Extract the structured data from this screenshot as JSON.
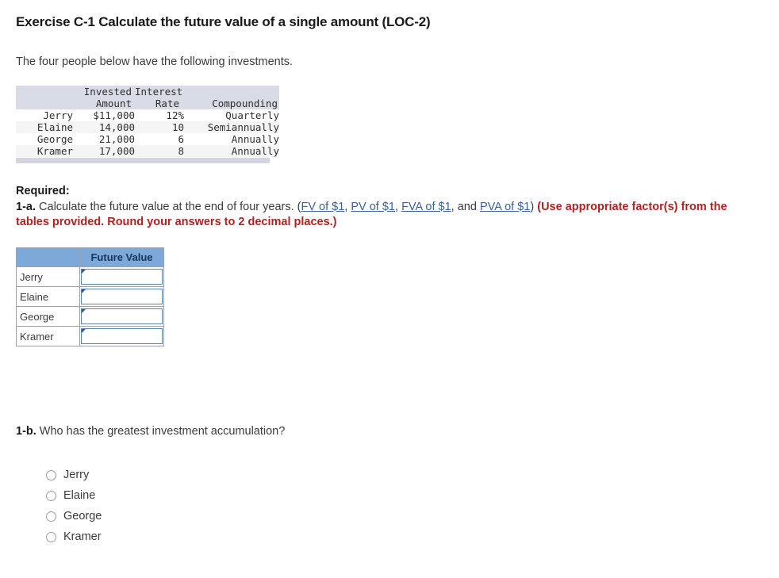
{
  "title": "Exercise C-1 Calculate the future value of a single amount (LOC-2)",
  "intro": "The four people below have the following investments.",
  "data_table": {
    "headers": {
      "name": "",
      "invested_amount_line1": "Invested",
      "invested_amount_line2": "Amount",
      "interest_rate_line1": "Interest",
      "interest_rate_line2": "Rate",
      "compounding": "Compounding"
    },
    "rows": [
      {
        "name": "Jerry",
        "amount": "$11,000",
        "rate": "12%",
        "compounding": "Quarterly"
      },
      {
        "name": "Elaine",
        "amount": "14,000",
        "rate": "10",
        "compounding": "Semiannually"
      },
      {
        "name": "George",
        "amount": "21,000",
        "rate": "6",
        "compounding": "Annually"
      },
      {
        "name": "Kramer",
        "amount": "17,000",
        "rate": "8",
        "compounding": "Annually"
      }
    ]
  },
  "required": {
    "label": "Required:",
    "number": "1-a.",
    "sentence": " Calculate the future value at the end of four years. (",
    "links": [
      {
        "text": "FV of $1"
      },
      {
        "text": "PV of $1"
      },
      {
        "text": "FVA of $1"
      },
      {
        "text": "PVA of $1"
      }
    ],
    "sep1": ", ",
    "sep2": ", ",
    "sep3": ", and ",
    "close_paren": ") ",
    "red_note": "(Use appropriate factor(s) from the tables provided. Round your answers to 2 decimal places.)"
  },
  "answer_table": {
    "blank_header": "",
    "value_header": "Future Value",
    "rows": [
      {
        "name": "Jerry",
        "value": ""
      },
      {
        "name": "Elaine",
        "value": ""
      },
      {
        "name": "George",
        "value": ""
      },
      {
        "name": "Kramer",
        "value": ""
      }
    ]
  },
  "question_b": {
    "number": "1-b.",
    "text": " Who has the greatest investment accumulation?",
    "options": [
      {
        "label": "Jerry"
      },
      {
        "label": "Elaine"
      },
      {
        "label": "George"
      },
      {
        "label": "Kramer"
      }
    ]
  }
}
